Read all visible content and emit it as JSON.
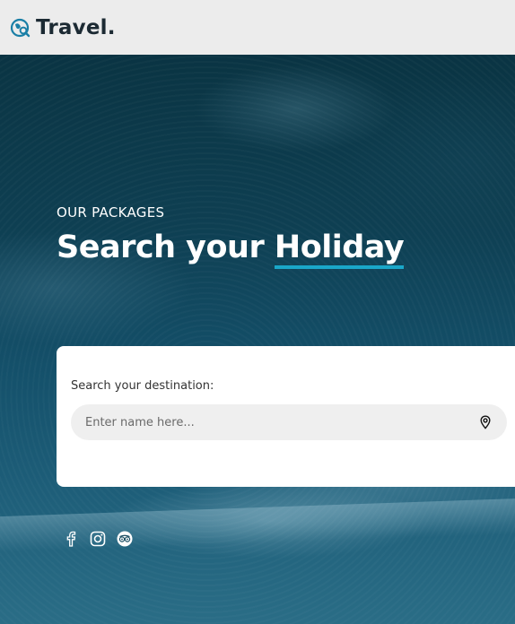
{
  "header": {
    "logo_text": "Travel."
  },
  "hero": {
    "eyebrow": "OUR PACKAGES",
    "headline_plain": "Search your ",
    "headline_highlight": "Holiday"
  },
  "search": {
    "label": "Search your destination:",
    "placeholder": "Enter name here...",
    "value": ""
  },
  "social": [
    "facebook-icon",
    "instagram-icon",
    "tripadvisor-icon"
  ],
  "colors": {
    "accent": "#1aa7c9",
    "logo_icon": "#1a7fa6",
    "header_bg": "#ececec",
    "text_dark": "#1c2a33"
  }
}
